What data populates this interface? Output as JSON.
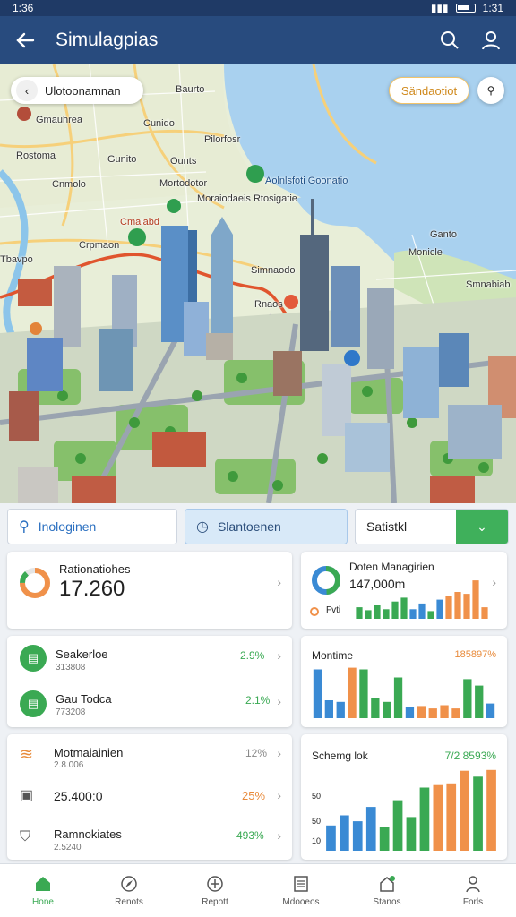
{
  "status": {
    "time": "1:36",
    "time_right": "1:31"
  },
  "header": {
    "title": "Simulagpias"
  },
  "map": {
    "location_label": "Ulotoonamnan",
    "filter_label": "Sändaotiot",
    "labels": [
      "Baurto",
      "Gmauhrea",
      "Cunido",
      "Pilorfosr",
      "Rostoma",
      "Gunito",
      "Cnmolo",
      "Ounts",
      "Mortodotor",
      "Aolnlsfoti Goonatio",
      "Moraiodaeis Rtosigatie",
      "Cmaiabd",
      "Crpmaon",
      "Tbavpo",
      "Ganto",
      "Simnaodo",
      "Monicle",
      "Smnabiab",
      "Rnaos"
    ]
  },
  "filters": {
    "search_label": "Inologinen",
    "station_label": "Slantoenen",
    "select_value": "Satistkl"
  },
  "cards": {
    "relations": {
      "title": "Rationatiohes",
      "value": "17.260"
    },
    "data_management": {
      "title": "Doten Managirien",
      "value": "147,000m",
      "legend": "Fvti"
    },
    "list1": [
      {
        "title": "Seakerloe",
        "sub": "313808",
        "pct": "2.9%"
      },
      {
        "title": "Gau Todca",
        "sub": "773208",
        "pct": "2.1%"
      }
    ],
    "montime": {
      "title": "Montime",
      "value": "185897%"
    },
    "list2": [
      {
        "title": "Motmaiainien",
        "sub": "2.8.006",
        "pct": "12%"
      },
      {
        "title": "25.400:0",
        "sub": "",
        "pct": "25%"
      },
      {
        "title": "Ramnokiates",
        "sub": "2.5240",
        "pct": "493%"
      }
    ],
    "schema": {
      "title": "Schemg lok",
      "value": "7/2 8593%",
      "axis": [
        "50",
        "50",
        "10"
      ]
    }
  },
  "charts": {
    "data_management": [
      {
        "v": 12,
        "c": "#3aa953"
      },
      {
        "v": 9,
        "c": "#3aa953"
      },
      {
        "v": 14,
        "c": "#3aa953"
      },
      {
        "v": 10,
        "c": "#3aa953"
      },
      {
        "v": 18,
        "c": "#3aa953"
      },
      {
        "v": 22,
        "c": "#3aa953"
      },
      {
        "v": 10,
        "c": "#3a8ad4"
      },
      {
        "v": 16,
        "c": "#3a8ad4"
      },
      {
        "v": 8,
        "c": "#3aa953"
      },
      {
        "v": 20,
        "c": "#3a8ad4"
      },
      {
        "v": 24,
        "c": "#f0914a"
      },
      {
        "v": 28,
        "c": "#f0914a"
      },
      {
        "v": 26,
        "c": "#f0914a"
      },
      {
        "v": 40,
        "c": "#f0914a"
      },
      {
        "v": 12,
        "c": "#f0914a"
      }
    ],
    "montime": [
      {
        "v": 60,
        "c": "#3a8ad4"
      },
      {
        "v": 22,
        "c": "#3a8ad4"
      },
      {
        "v": 20,
        "c": "#3a8ad4"
      },
      {
        "v": 62,
        "c": "#f0914a"
      },
      {
        "v": 60,
        "c": "#3aa953"
      },
      {
        "v": 25,
        "c": "#3aa953"
      },
      {
        "v": 20,
        "c": "#3aa953"
      },
      {
        "v": 50,
        "c": "#3aa953"
      },
      {
        "v": 14,
        "c": "#3a8ad4"
      },
      {
        "v": 15,
        "c": "#f0914a"
      },
      {
        "v": 12,
        "c": "#f0914a"
      },
      {
        "v": 16,
        "c": "#f0914a"
      },
      {
        "v": 12,
        "c": "#f0914a"
      },
      {
        "v": 48,
        "c": "#3aa953"
      },
      {
        "v": 40,
        "c": "#3aa953"
      },
      {
        "v": 18,
        "c": "#3a8ad4"
      }
    ],
    "schema": [
      {
        "v": 30,
        "c": "#3a8ad4"
      },
      {
        "v": 42,
        "c": "#3a8ad4"
      },
      {
        "v": 35,
        "c": "#3a8ad4"
      },
      {
        "v": 52,
        "c": "#3a8ad4"
      },
      {
        "v": 28,
        "c": "#3aa953"
      },
      {
        "v": 60,
        "c": "#3aa953"
      },
      {
        "v": 40,
        "c": "#3aa953"
      },
      {
        "v": 75,
        "c": "#3aa953"
      },
      {
        "v": 78,
        "c": "#f0914a"
      },
      {
        "v": 80,
        "c": "#f0914a"
      },
      {
        "v": 95,
        "c": "#f0914a"
      },
      {
        "v": 88,
        "c": "#3aa953"
      },
      {
        "v": 96,
        "c": "#f0914a"
      }
    ]
  },
  "bottom_nav": [
    "Hone",
    "Renots",
    "Repott",
    "Mdooeos",
    "Stanos",
    "Forls"
  ]
}
